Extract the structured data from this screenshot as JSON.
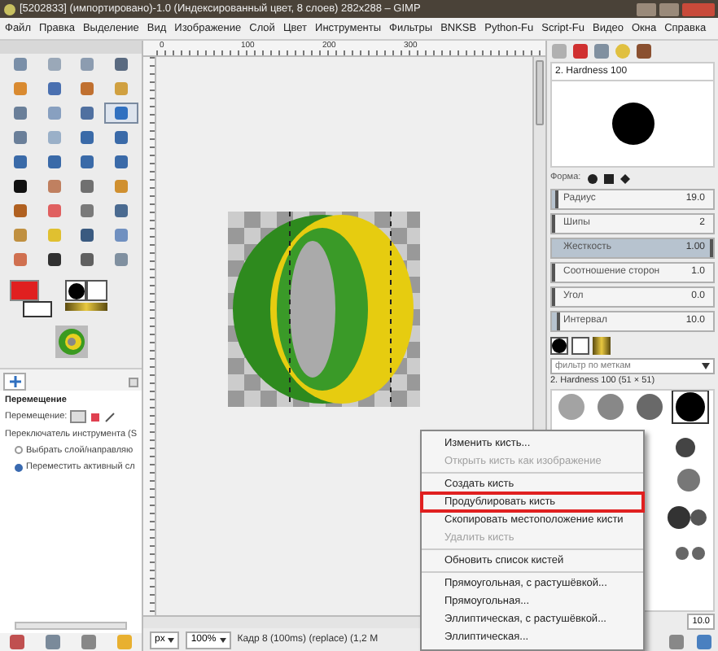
{
  "window": {
    "title": "[5202833] (импортировано)-1.0 (Индексированный цвет, 8 слоев) 282x288 – GIMP"
  },
  "menu": [
    "Файл",
    "Правка",
    "Выделение",
    "Вид",
    "Изображение",
    "Слой",
    "Цвет",
    "Инструменты",
    "Фильтры",
    "BNKSB",
    "Python-Fu",
    "Script-Fu",
    "Видео",
    "Окна",
    "Справка"
  ],
  "toolbox": {
    "tools": [
      {
        "selected": false
      },
      {
        "selected": false
      },
      {
        "selected": false
      },
      {
        "selected": false
      },
      {
        "selected": false
      },
      {
        "selected": false
      },
      {
        "selected": false
      },
      {
        "selected": false
      },
      {
        "selected": false
      },
      {
        "selected": false
      },
      {
        "selected": false
      },
      {
        "selected": true
      },
      {
        "selected": false
      },
      {
        "selected": false
      },
      {
        "selected": false
      },
      {
        "selected": false
      },
      {
        "selected": false
      },
      {
        "selected": false
      },
      {
        "selected": false
      },
      {
        "selected": false
      },
      {
        "selected": false
      },
      {
        "selected": false
      },
      {
        "selected": false
      },
      {
        "selected": false
      },
      {
        "selected": false
      },
      {
        "selected": false
      },
      {
        "selected": false
      },
      {
        "selected": false
      },
      {
        "selected": false
      },
      {
        "selected": false
      },
      {
        "selected": false
      },
      {
        "selected": false
      },
      {
        "selected": false
      },
      {
        "selected": false
      },
      {
        "selected": false
      },
      {
        "selected": false
      }
    ]
  },
  "tool_options": {
    "heading": "Перемещение",
    "mode_label": "Перемещение:",
    "switch_label": "Переключатель инструмента (S",
    "radios": [
      {
        "label": "Выбрать слой/направляю",
        "selected": false
      },
      {
        "label": "Переместить активный сл",
        "selected": true
      }
    ]
  },
  "ruler": {
    "labels": [
      "0",
      "100",
      "200",
      "300"
    ]
  },
  "status_bar": {
    "unit": "px",
    "zoom": "100%",
    "message": "Кадр 8 (100ms) (replace) (1,2 M"
  },
  "brush_editor": {
    "name": "2. Hardness 100",
    "shape_label": "Форма:",
    "sliders": [
      {
        "label": "Радиус",
        "value": "19.0",
        "level": 0.04
      },
      {
        "label": "Шипы",
        "value": "2",
        "level": 0
      },
      {
        "label": "Жесткость",
        "value": "1.00",
        "level": 1
      },
      {
        "label": "Соотношение сторон",
        "value": "1.0",
        "level": 0
      },
      {
        "label": "Угол",
        "value": "0.0",
        "level": 0
      },
      {
        "label": "Интервал",
        "value": "10.0",
        "level": 0.05
      }
    ]
  },
  "brushes": {
    "filter_placeholder": "фильтр по меткам",
    "selected_caption": "2. Hardness 100 (51 × 51)",
    "spacing": "10.0"
  },
  "context_menu": {
    "groups": [
      {
        "items": [
          {
            "label": "Изменить кисть...",
            "disabled": false,
            "highlighted": false
          },
          {
            "label": "Открыть кисть как изображение",
            "disabled": true,
            "highlighted": false
          }
        ]
      },
      {
        "items": [
          {
            "label": "Создать кисть",
            "disabled": false,
            "highlighted": false
          },
          {
            "label": "Продублировать кисть",
            "disabled": false,
            "highlighted": true
          },
          {
            "label": "Скопировать местоположение кисти",
            "disabled": false,
            "highlighted": false
          },
          {
            "label": "Удалить кисть",
            "disabled": true,
            "highlighted": false
          }
        ]
      },
      {
        "items": [
          {
            "label": "Обновить список кистей",
            "disabled": false,
            "highlighted": false
          }
        ]
      },
      {
        "items": [
          {
            "label": "Прямоугольная, с растушёвкой...",
            "disabled": false,
            "highlighted": false
          },
          {
            "label": "Прямоугольная...",
            "disabled": false,
            "highlighted": false
          },
          {
            "label": "Эллиптическая, с растушёвкой...",
            "disabled": false,
            "highlighted": false
          },
          {
            "label": "Эллиптическая...",
            "disabled": false,
            "highlighted": false
          }
        ]
      }
    ]
  }
}
